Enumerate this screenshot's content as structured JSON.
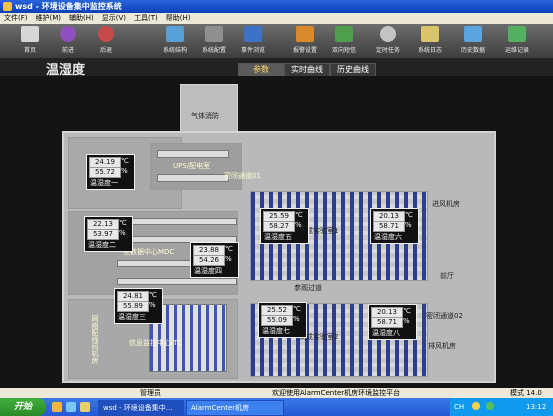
{
  "window": {
    "title": "wsd - 环境设备集中监控系统"
  },
  "menu": [
    "文件(F)",
    "维护(M)",
    "辅助(H)",
    "显示(V)",
    "工具(T)",
    "帮助(H)"
  ],
  "toolbar": [
    {
      "label": "首页",
      "icon": "home-icon",
      "color": "#d7d7d7"
    },
    {
      "label": "前进",
      "icon": "forward-icon",
      "color": "#8e4fbf"
    },
    {
      "label": "后退",
      "icon": "back-icon",
      "color": "#c84a48"
    },
    {
      "label": "系统结构",
      "icon": "structure-icon",
      "color": "#56a0d6"
    },
    {
      "label": "系统配置",
      "icon": "config-icon",
      "color": "#8f8f8f"
    },
    {
      "label": "事件浏览",
      "icon": "events-icon",
      "color": "#3d72c7"
    },
    {
      "label": "报警设置",
      "icon": "alarm-icon",
      "color": "#d88a2d"
    },
    {
      "label": "双向短信",
      "icon": "sms-icon",
      "color": "#4f9f4f"
    },
    {
      "label": "定时任务",
      "icon": "timer-icon",
      "color": "#c3c3c3"
    },
    {
      "label": "系统日志",
      "icon": "log-icon",
      "color": "#d9c46a"
    },
    {
      "label": "历史数据",
      "icon": "history-icon",
      "color": "#5aa4e0"
    },
    {
      "label": "运维记录",
      "icon": "maintenance-icon",
      "color": "#54b060"
    }
  ],
  "page": {
    "title": "温湿度",
    "tabs": [
      "参数",
      "实时曲线",
      "历史曲线"
    ],
    "active_tab": 0
  },
  "rooms": {
    "fire": "气体消防",
    "ups": "UPS/配电室",
    "corridor1": "密闭通道01",
    "mdc": "主数据中心MDC",
    "lab1": "集成实验室1",
    "inlet": "进风机房",
    "lobby": "前厅",
    "visit": "参观过道",
    "itc": "信息监控中心ITC",
    "lab2": "集成实验室2",
    "corridor2": "密闭通道02",
    "exhaust": "排风机房",
    "network": "网络配线间机房"
  },
  "sensors": [
    {
      "temp": "24.19",
      "hum": "55.72",
      "name": "温湿度一"
    },
    {
      "temp": "22.13",
      "hum": "53.97",
      "name": "温湿度二"
    },
    {
      "temp": "23.88",
      "hum": "54.26",
      "name": "温湿度四"
    },
    {
      "temp": "25.59",
      "hum": "58.27",
      "name": "温湿度五"
    },
    {
      "temp": "20.13",
      "hum": "58.71",
      "name": "温湿度六"
    },
    {
      "temp": "24.81",
      "hum": "55.89",
      "name": "温湿度三"
    },
    {
      "temp": "25.52",
      "hum": "55.09",
      "name": "温湿度七"
    },
    {
      "temp": "20.13",
      "hum": "58.71",
      "name": "温湿度八"
    }
  ],
  "units": {
    "temp": "℃",
    "hum": "%"
  },
  "status": {
    "user": "管理员",
    "message": "欢迎使用AlarmCenter机房环境监控平台",
    "extra": "模式 14.0"
  },
  "taskbar": {
    "start": "开始",
    "tasks": [
      "wsd - 环境设备集中...",
      "AlarmCenter机房"
    ],
    "clock": "13:12",
    "lang": "CH"
  }
}
